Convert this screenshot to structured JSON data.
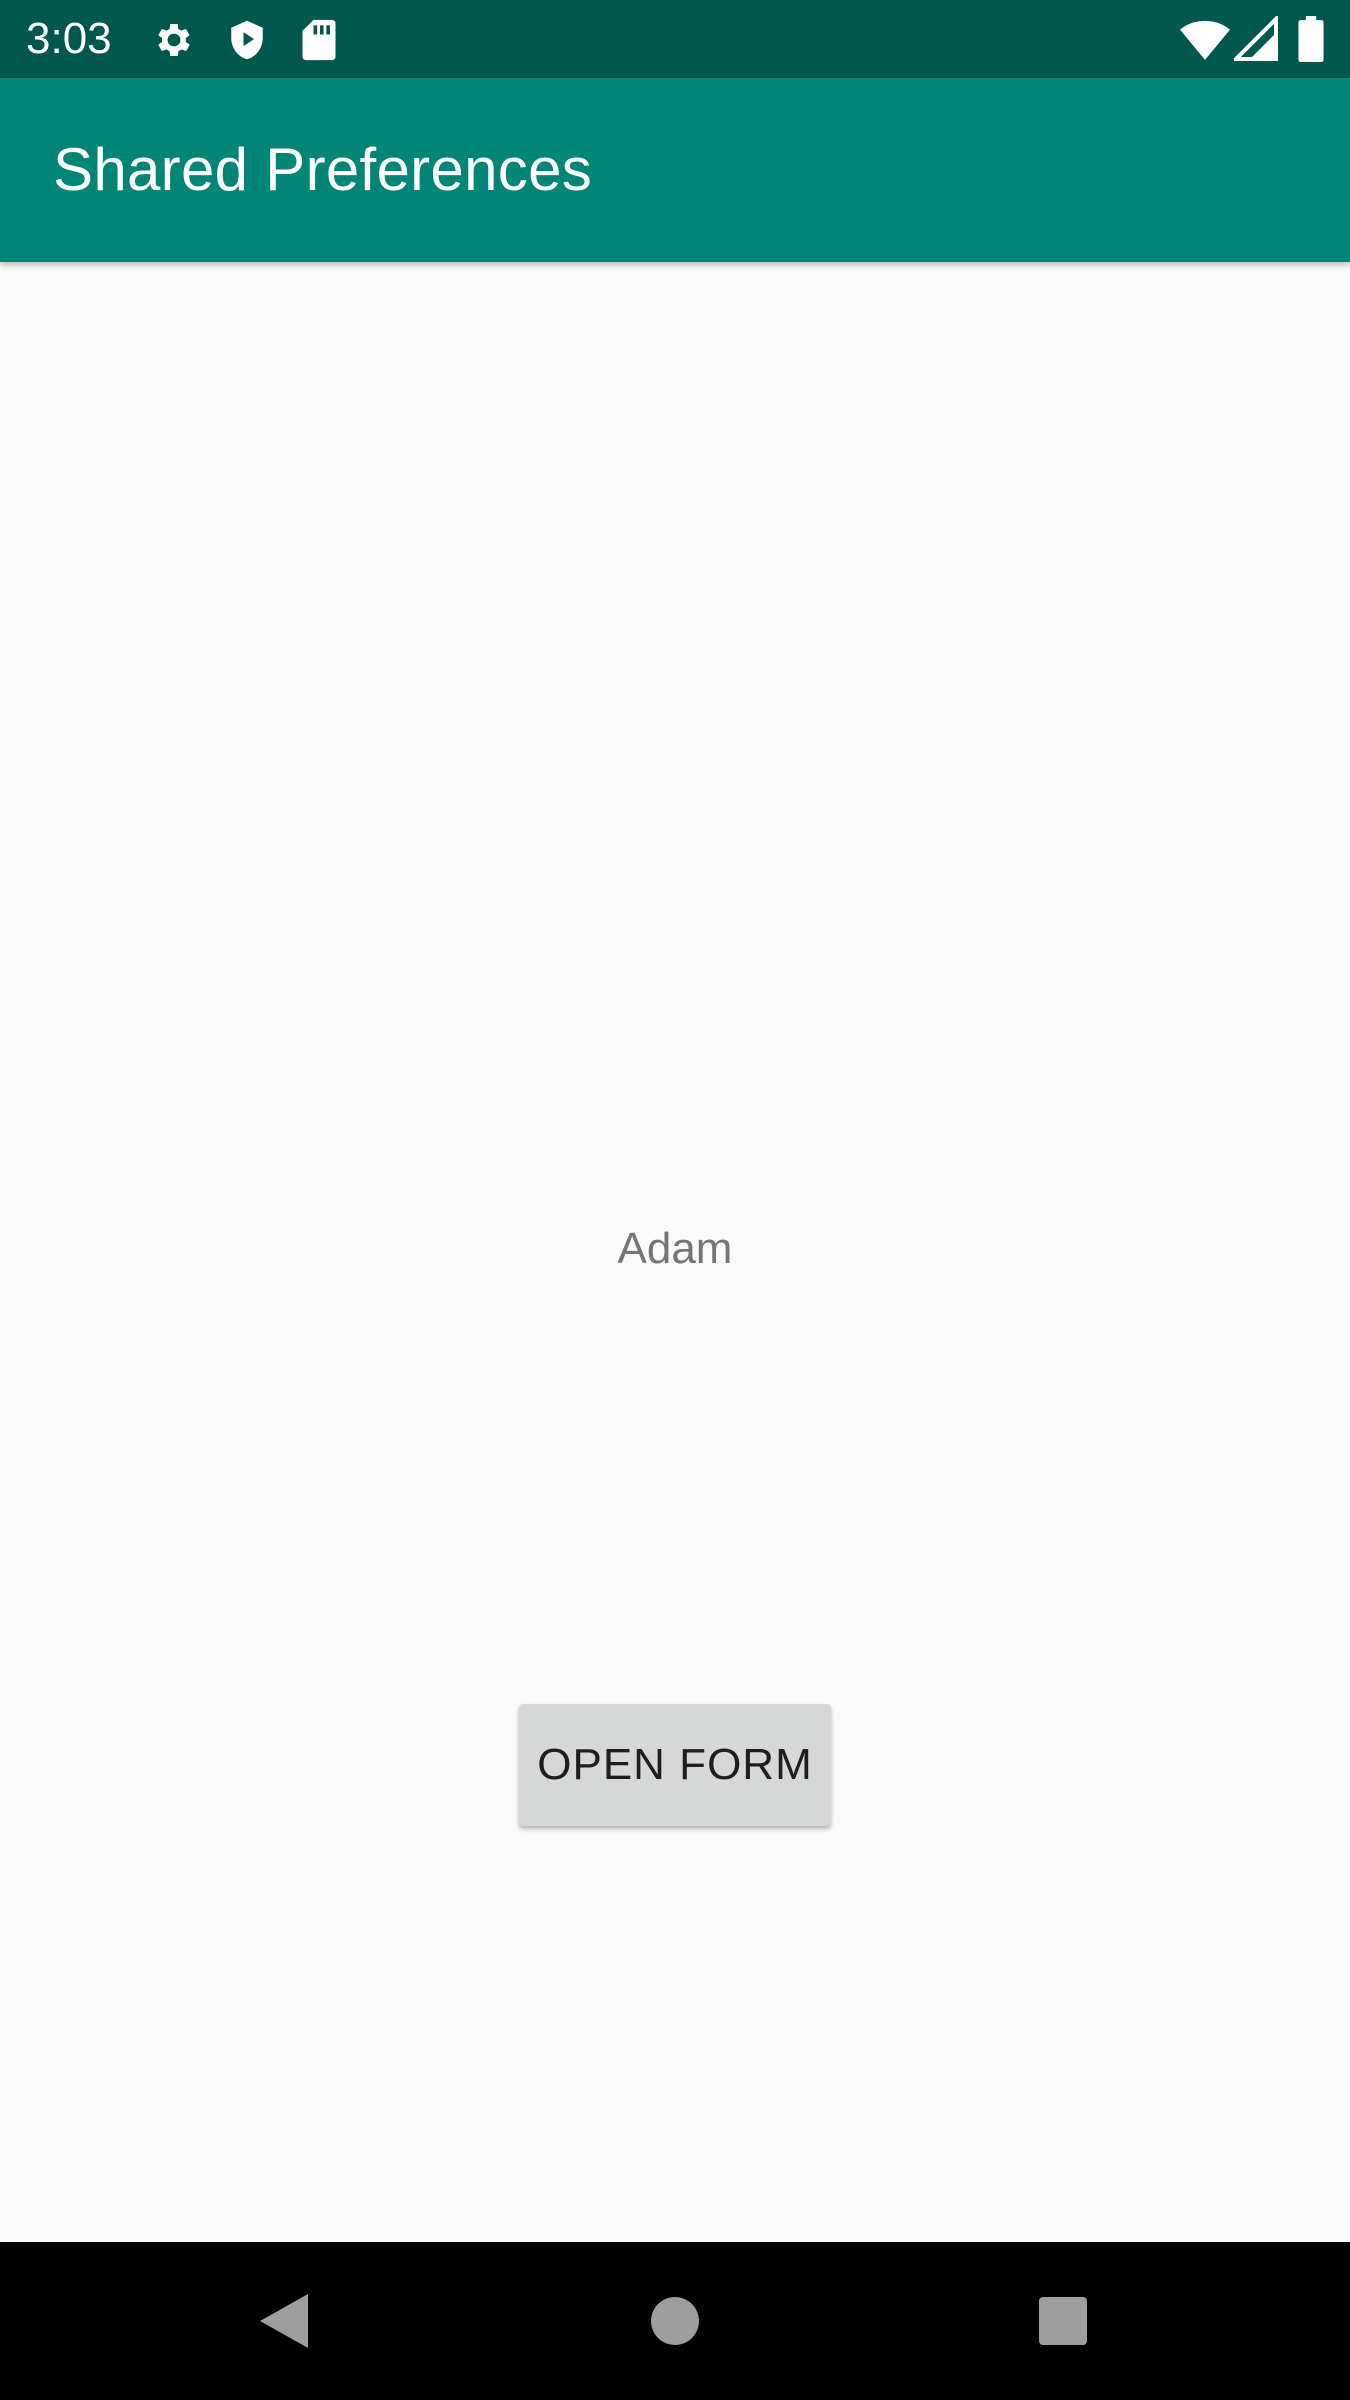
{
  "status_bar": {
    "time": "3:03",
    "left_icons": [
      "settings-gear-icon",
      "shield-play-icon",
      "sd-card-icon"
    ],
    "right_icons": [
      "wifi-icon",
      "cell-signal-icon",
      "battery-icon"
    ]
  },
  "app_bar": {
    "title": "Shared Preferences",
    "background": "#018577"
  },
  "main": {
    "name_text": "Adam",
    "open_form_label": "OPEN FORM"
  },
  "nav_bar": {
    "buttons": [
      "back-icon",
      "home-icon",
      "recents-icon"
    ]
  },
  "colors": {
    "status_bar": "#00574d",
    "app_bar": "#018577",
    "background": "#fafafa",
    "button": "#d6d7d7"
  }
}
